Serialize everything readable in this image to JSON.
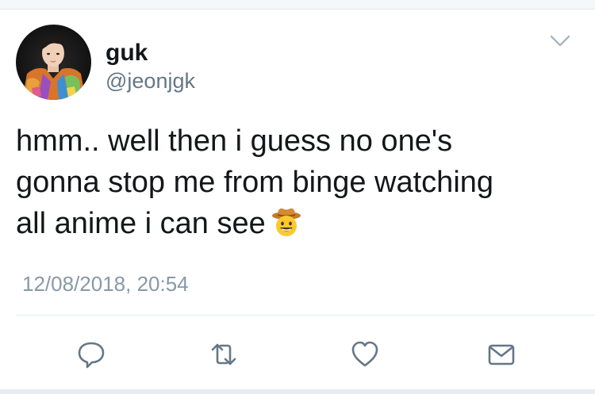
{
  "user": {
    "name": "guk",
    "handle": "@jeonjgk"
  },
  "tweet": {
    "text": "hmm.. well then i guess no one's\ngonna stop me from binge watching\nall anime i can see",
    "emoji": "cowboy-hat-face",
    "timestamp": "12/08/2018, 20:54"
  },
  "actions": {
    "reply_icon": "reply-icon",
    "retweet_icon": "retweet-icon",
    "like_icon": "heart-icon",
    "dm_icon": "envelope-icon"
  },
  "colors": {
    "text": "#14171a",
    "secondary": "#657786",
    "timestamp": "#8899a6",
    "icon": "#657786",
    "border": "#e1e8ed"
  }
}
